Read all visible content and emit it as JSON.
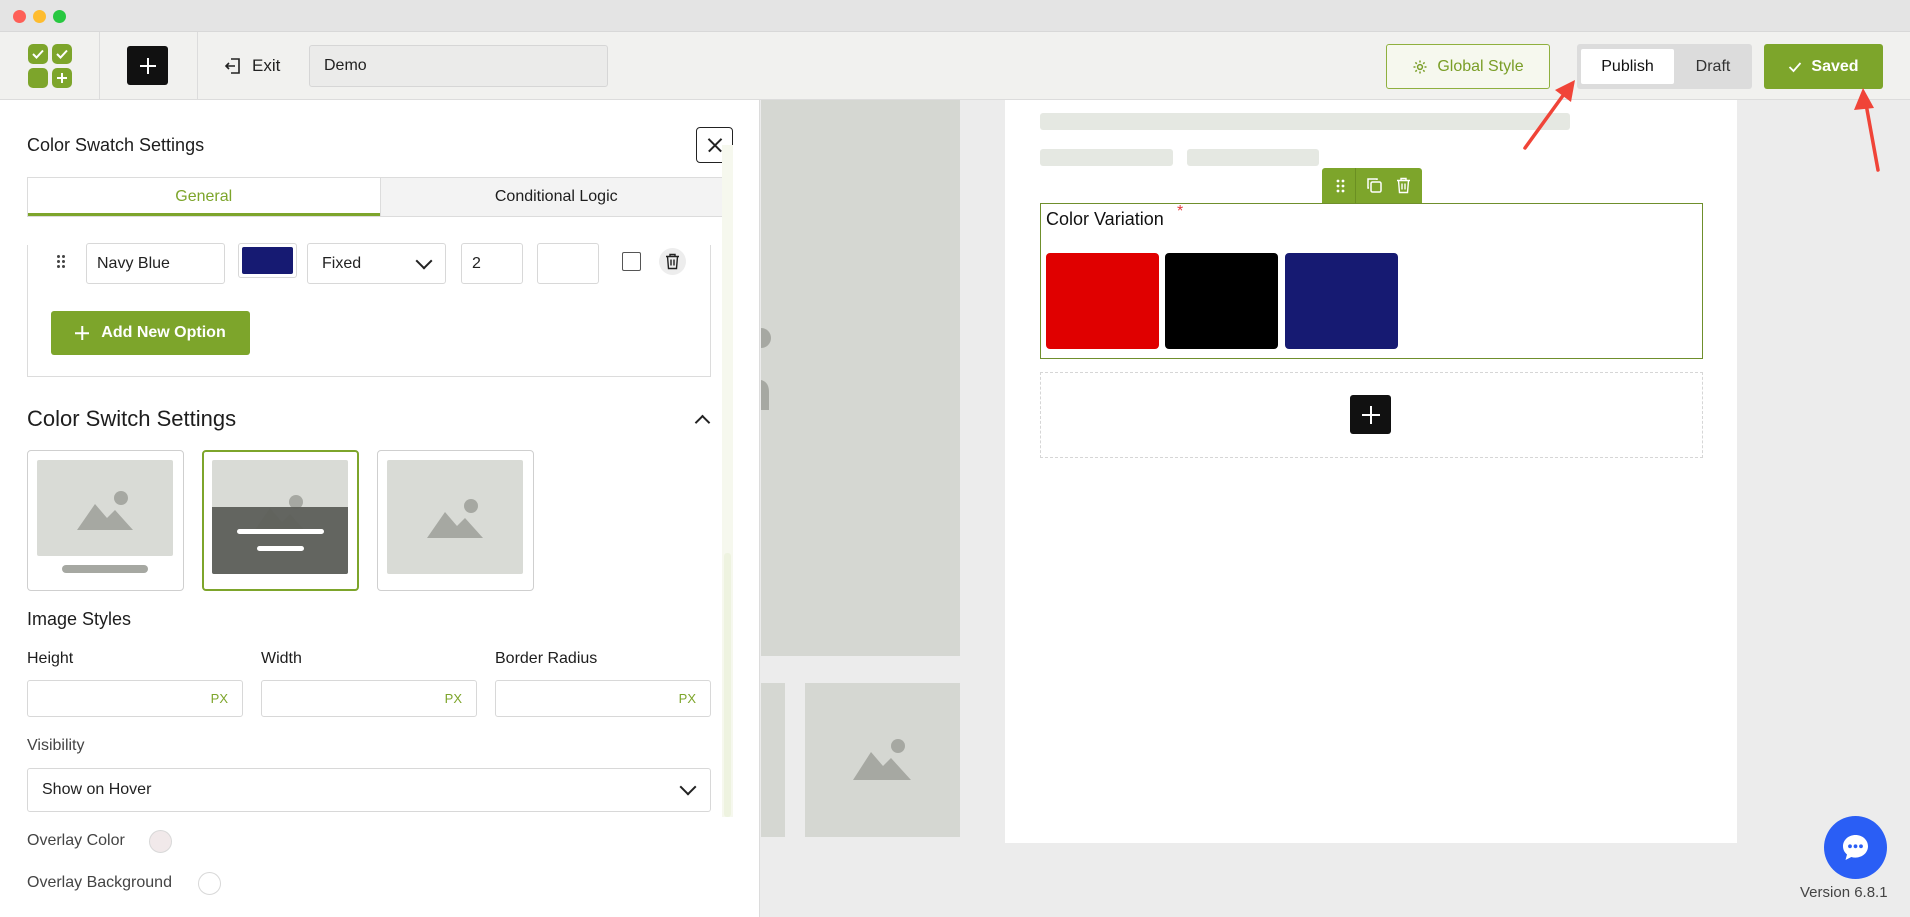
{
  "toolbar": {
    "exit_label": "Exit",
    "title_value": "Demo",
    "global_style_label": "Global Style",
    "publish_label": "Publish",
    "draft_label": "Draft",
    "saved_label": "Saved",
    "accent_color": "#7da52b"
  },
  "panel": {
    "title": "Color Swatch Settings",
    "tabs": [
      {
        "label": "General",
        "active": true
      },
      {
        "label": "Conditional Logic",
        "active": false
      }
    ],
    "option_row": {
      "name": "Navy Blue",
      "color": "#161a72",
      "price_type": "Fixed",
      "price": "2"
    },
    "add_option_label": "Add New Option",
    "switch_settings_title": "Color Switch Settings",
    "image_styles_title": "Image Styles",
    "height_label": "Height",
    "width_label": "Width",
    "border_radius_label": "Border Radius",
    "unit": "PX",
    "visibility_label": "Visibility",
    "visibility_value": "Show on Hover",
    "overlay_color_label": "Overlay Color",
    "overlay_background_label": "Overlay Background"
  },
  "canvas": {
    "field_label": "Color Variation",
    "required_mark": "*",
    "swatches": [
      {
        "name": "Red",
        "color": "#e00000"
      },
      {
        "name": "Black",
        "color": "#000000"
      },
      {
        "name": "Navy Blue",
        "color": "#161a72"
      }
    ]
  },
  "footer": {
    "version": "Version 6.8.1"
  }
}
